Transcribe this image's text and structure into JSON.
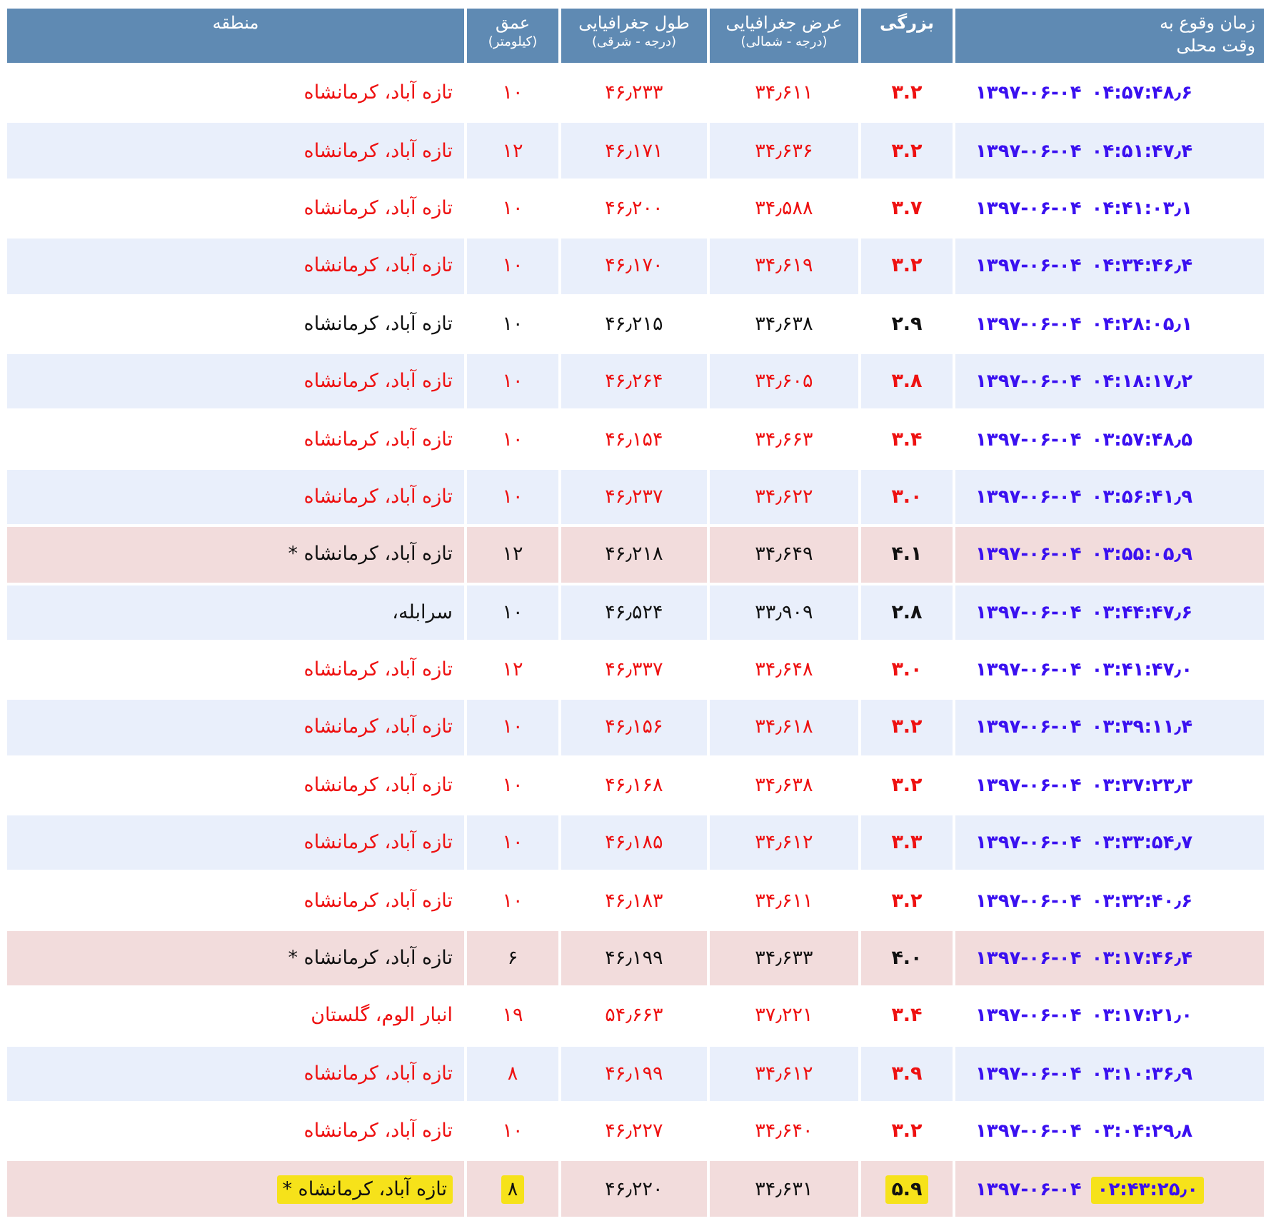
{
  "columns": [
    {
      "title": "زمان وقوع به",
      "subtitle": "وقت محلی"
    },
    {
      "title": "بزرگی"
    },
    {
      "title": "عرض جغرافیایی",
      "subtitle": "(درجه - شمالی)"
    },
    {
      "title": "طول جغرافیایی",
      "subtitle": "(درجه - شرقی)"
    },
    {
      "title": "عمق",
      "subtitle": "(کیلومتر)"
    },
    {
      "title": "منطقه"
    }
  ],
  "rows": [
    {
      "kind": "minor",
      "highlighted": false,
      "date": "۱۳۹۷-۰۶-۰۴",
      "time": "۰۴:۵۷:۴۸٫۶",
      "magnitude": "۳.۲",
      "latitude": "۳۴٫۶۱۱",
      "longitude": "۴۶٫۲۳۳",
      "depth": "۱۰",
      "region": "تازه آباد، کرمانشاه"
    },
    {
      "kind": "minor",
      "highlighted": false,
      "date": "۱۳۹۷-۰۶-۰۴",
      "time": "۰۴:۵۱:۴۷٫۴",
      "magnitude": "۳.۲",
      "latitude": "۳۴٫۶۳۶",
      "longitude": "۴۶٫۱۷۱",
      "depth": "۱۲",
      "region": "تازه آباد، کرمانشاه"
    },
    {
      "kind": "minor",
      "highlighted": false,
      "date": "۱۳۹۷-۰۶-۰۴",
      "time": "۰۴:۴۱:۰۳٫۱",
      "magnitude": "۳.۷",
      "latitude": "۳۴٫۵۸۸",
      "longitude": "۴۶٫۲۰۰",
      "depth": "۱۰",
      "region": "تازه آباد، کرمانشاه"
    },
    {
      "kind": "minor",
      "highlighted": false,
      "date": "۱۳۹۷-۰۶-۰۴",
      "time": "۰۴:۳۴:۴۶٫۴",
      "magnitude": "۳.۲",
      "latitude": "۳۴٫۶۱۹",
      "longitude": "۴۶٫۱۷۰",
      "depth": "۱۰",
      "region": "تازه آباد، کرمانشاه"
    },
    {
      "kind": "normal",
      "highlighted": false,
      "date": "۱۳۹۷-۰۶-۰۴",
      "time": "۰۴:۲۸:۰۵٫۱",
      "magnitude": "۲.۹",
      "latitude": "۳۴٫۶۳۸",
      "longitude": "۴۶٫۲۱۵",
      "depth": "۱۰",
      "region": "تازه آباد، کرمانشاه"
    },
    {
      "kind": "minor",
      "highlighted": false,
      "date": "۱۳۹۷-۰۶-۰۴",
      "time": "۰۴:۱۸:۱۷٫۲",
      "magnitude": "۳.۸",
      "latitude": "۳۴٫۶۰۵",
      "longitude": "۴۶٫۲۶۴",
      "depth": "۱۰",
      "region": "تازه آباد، کرمانشاه"
    },
    {
      "kind": "minor",
      "highlighted": false,
      "date": "۱۳۹۷-۰۶-۰۴",
      "time": "۰۳:۵۷:۴۸٫۵",
      "magnitude": "۳.۴",
      "latitude": "۳۴٫۶۶۳",
      "longitude": "۴۶٫۱۵۴",
      "depth": "۱۰",
      "region": "تازه آباد، کرمانشاه"
    },
    {
      "kind": "minor",
      "highlighted": false,
      "date": "۱۳۹۷-۰۶-۰۴",
      "time": "۰۳:۵۶:۴۱٫۹",
      "magnitude": "۳.۰",
      "latitude": "۳۴٫۶۲۲",
      "longitude": "۴۶٫۲۳۷",
      "depth": "۱۰",
      "region": "تازه آباد، کرمانشاه"
    },
    {
      "kind": "major",
      "highlighted": false,
      "date": "۱۳۹۷-۰۶-۰۴",
      "time": "۰۳:۵۵:۰۵٫۹",
      "magnitude": "۴.۱",
      "latitude": "۳۴٫۶۴۹",
      "longitude": "۴۶٫۲۱۸",
      "depth": "۱۲",
      "region": "تازه آباد، کرمانشاه *"
    },
    {
      "kind": "normal",
      "highlighted": false,
      "date": "۱۳۹۷-۰۶-۰۴",
      "time": "۰۳:۴۴:۴۷٫۶",
      "magnitude": "۲.۸",
      "latitude": "۳۳٫۹۰۹",
      "longitude": "۴۶٫۵۲۴",
      "depth": "۱۰",
      "region": "سرابله،"
    },
    {
      "kind": "minor",
      "highlighted": false,
      "date": "۱۳۹۷-۰۶-۰۴",
      "time": "۰۳:۴۱:۴۷٫۰",
      "magnitude": "۳.۰",
      "latitude": "۳۴٫۶۴۸",
      "longitude": "۴۶٫۳۳۷",
      "depth": "۱۲",
      "region": "تازه آباد، کرمانشاه"
    },
    {
      "kind": "minor",
      "highlighted": false,
      "date": "۱۳۹۷-۰۶-۰۴",
      "time": "۰۳:۳۹:۱۱٫۴",
      "magnitude": "۳.۲",
      "latitude": "۳۴٫۶۱۸",
      "longitude": "۴۶٫۱۵۶",
      "depth": "۱۰",
      "region": "تازه آباد، کرمانشاه"
    },
    {
      "kind": "minor",
      "highlighted": false,
      "date": "۱۳۹۷-۰۶-۰۴",
      "time": "۰۳:۳۷:۲۳٫۳",
      "magnitude": "۳.۲",
      "latitude": "۳۴٫۶۳۸",
      "longitude": "۴۶٫۱۶۸",
      "depth": "۱۰",
      "region": "تازه آباد، کرمانشاه"
    },
    {
      "kind": "minor",
      "highlighted": false,
      "date": "۱۳۹۷-۰۶-۰۴",
      "time": "۰۳:۳۳:۵۴٫۷",
      "magnitude": "۳.۳",
      "latitude": "۳۴٫۶۱۲",
      "longitude": "۴۶٫۱۸۵",
      "depth": "۱۰",
      "region": "تازه آباد، کرمانشاه"
    },
    {
      "kind": "minor",
      "highlighted": false,
      "date": "۱۳۹۷-۰۶-۰۴",
      "time": "۰۳:۳۲:۴۰٫۶",
      "magnitude": "۳.۲",
      "latitude": "۳۴٫۶۱۱",
      "longitude": "۴۶٫۱۸۳",
      "depth": "۱۰",
      "region": "تازه آباد، کرمانشاه"
    },
    {
      "kind": "major",
      "highlighted": false,
      "date": "۱۳۹۷-۰۶-۰۴",
      "time": "۰۳:۱۷:۴۶٫۴",
      "magnitude": "۴.۰",
      "latitude": "۳۴٫۶۳۳",
      "longitude": "۴۶٫۱۹۹",
      "depth": "۶",
      "region": "تازه آباد، کرمانشاه *"
    },
    {
      "kind": "minor",
      "highlighted": false,
      "date": "۱۳۹۷-۰۶-۰۴",
      "time": "۰۳:۱۷:۲۱٫۰",
      "magnitude": "۳.۴",
      "latitude": "۳۷٫۲۲۱",
      "longitude": "۵۴٫۶۶۳",
      "depth": "۱۹",
      "region": "انبار الوم، گلستان"
    },
    {
      "kind": "minor",
      "highlighted": false,
      "date": "۱۳۹۷-۰۶-۰۴",
      "time": "۰۳:۱۰:۳۶٫۹",
      "magnitude": "۳.۹",
      "latitude": "۳۴٫۶۱۲",
      "longitude": "۴۶٫۱۹۹",
      "depth": "۸",
      "region": "تازه آباد، کرمانشاه"
    },
    {
      "kind": "minor",
      "highlighted": false,
      "date": "۱۳۹۷-۰۶-۰۴",
      "time": "۰۳:۰۴:۲۹٫۸",
      "magnitude": "۳.۲",
      "latitude": "۳۴٫۶۴۰",
      "longitude": "۴۶٫۲۲۷",
      "depth": "۱۰",
      "region": "تازه آباد، کرمانشاه"
    },
    {
      "kind": "major",
      "highlighted": true,
      "date": "۱۳۹۷-۰۶-۰۴",
      "time": "۰۲:۴۳:۲۵٫۰",
      "magnitude": "۵.۹",
      "latitude": "۳۴٫۶۳۱",
      "longitude": "۴۶٫۲۲۰",
      "depth": "۸",
      "region": "تازه آباد، کرمانشاه *"
    }
  ]
}
